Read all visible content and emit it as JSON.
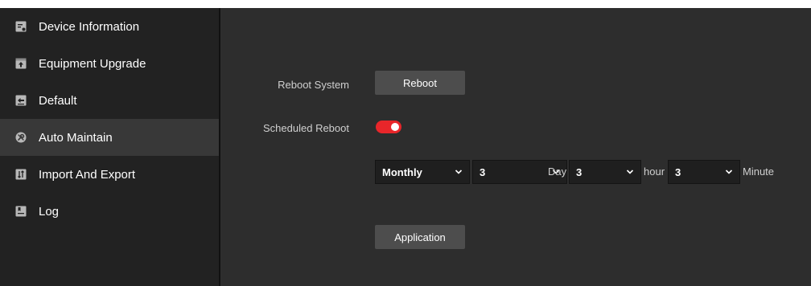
{
  "sidebar": {
    "items": [
      {
        "label": "Device Information",
        "icon": "device-info-icon"
      },
      {
        "label": "Equipment Upgrade",
        "icon": "upgrade-icon"
      },
      {
        "label": "Default",
        "icon": "default-icon"
      },
      {
        "label": "Auto Maintain",
        "icon": "wrench-icon",
        "active": true
      },
      {
        "label": "Import And Export",
        "icon": "import-export-icon"
      },
      {
        "label": "Log",
        "icon": "log-icon"
      }
    ]
  },
  "main": {
    "reboot_system_label": "Reboot System",
    "reboot_button": "Reboot",
    "scheduled_reboot_label": "Scheduled Reboot",
    "scheduled_reboot_enabled": true,
    "schedule": {
      "frequency": "Monthly",
      "day_value": "3",
      "day_unit": "Day",
      "hour_value": "3",
      "hour_unit": "hour",
      "minute_value": "3",
      "minute_unit": "Minute"
    },
    "apply_button": "Application"
  },
  "colors": {
    "sidebar_bg": "#222222",
    "sidebar_active_bg": "#383838",
    "main_bg": "#2d2d2d",
    "toggle_on": "#e8262a",
    "button_bg": "#4d4d4d"
  }
}
